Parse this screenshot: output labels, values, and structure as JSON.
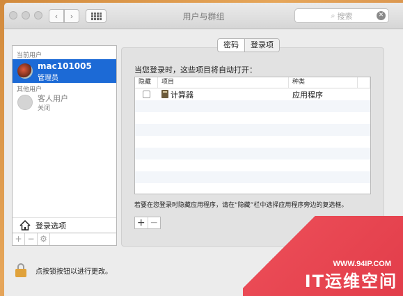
{
  "window": {
    "title": "用户与群组"
  },
  "search": {
    "placeholder": "搜索"
  },
  "sidebar": {
    "current_users_label": "当前用户",
    "current_user": {
      "name": "mac101005",
      "role": "管理员"
    },
    "other_users_label": "其他用户",
    "guest_user": {
      "name": "客人用户",
      "status": "关闭"
    },
    "login_options_label": "登录选项",
    "tools": [
      "+",
      "−",
      "⚙"
    ]
  },
  "tabs": [
    {
      "label": "密码",
      "active": false
    },
    {
      "label": "登录项",
      "active": true
    }
  ],
  "login_items": {
    "heading": "当您登录时，这些项目将自动打开：",
    "columns": [
      "隐藏",
      "项目",
      "种类"
    ],
    "rows": [
      {
        "hidden": false,
        "item": "计算器",
        "kind": "应用程序"
      }
    ],
    "hint": "若要在您登录时隐藏应用程序，请在“隐藏”栏中选择应用程序旁边的复选框。",
    "add_label": "+",
    "remove_label": "−"
  },
  "lock": {
    "label": "点按锁按钮以进行更改。"
  },
  "watermark": {
    "url": "WWW.94IP.COM",
    "text": "IT运维空间"
  },
  "colors": {
    "selection": "#1c6ad6",
    "lock": "#e0a23b",
    "watermark": "#e23d4a"
  }
}
